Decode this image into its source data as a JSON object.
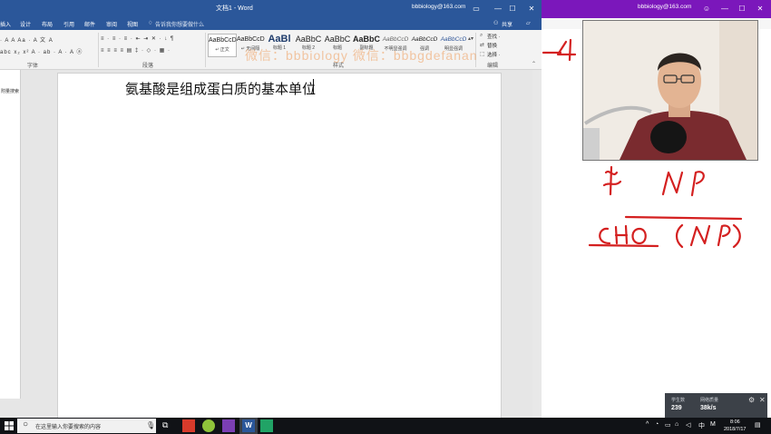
{
  "word": {
    "title": "文档1 - Word",
    "account": "bbbiology@163.com",
    "tabs": [
      "插入",
      "设计",
      "布局",
      "引用",
      "邮件",
      "审阅",
      "视图"
    ],
    "tell_me": "告诉我你想要做什么",
    "share": "共享",
    "font_row1": "· A A Aa · A 文 A",
    "font_row2": "abc x₂ x² A · ab · A · A ⓐ",
    "para_row1": "≡ · ≡ · ≡ · ⇤ ⇥ ✕ · ↓ ¶",
    "para_row2": "≡ ≡ ≡ ≡ ▤ ‡ · ◇ · ▦ ·",
    "group_font": "字体",
    "group_paragraph": "段落",
    "group_styles": "样式",
    "group_editing": "编辑",
    "styles": [
      {
        "sample": "AaBbCcD",
        "name": "↵ 正文"
      },
      {
        "sample": "AaBbCcD",
        "name": "↵ 无间隔"
      },
      {
        "sample": "AaBl",
        "name": "标题 1"
      },
      {
        "sample": "AaBbC",
        "name": "标题 2"
      },
      {
        "sample": "AaBbC",
        "name": "标题"
      },
      {
        "sample": "AaBbC",
        "name": "副标题"
      },
      {
        "sample": "AaBbCcD",
        "name": "不明显强调"
      },
      {
        "sample": "AaBbCcD",
        "name": "强调"
      },
      {
        "sample": "AaBbCcD",
        "name": "明显强调"
      }
    ],
    "editing": [
      "查找 ·",
      "替换",
      "选择 ·"
    ],
    "nav_text": "附量搜索",
    "document_text": "氨基酸是组成蛋白质的基本单位",
    "watermark": "微信：bbbiology  微信：bbbgdefanan"
  },
  "whiteboard": {
    "account": "bbbiology@163.com",
    "ink_color": "#d42020"
  },
  "stats": {
    "label_1": "学生数",
    "value_1": "239",
    "label_2": "网络质量",
    "value_2": "38k/s"
  },
  "taskbar": {
    "search_placeholder": "在这里输入你要搜索的内容",
    "ime": "中",
    "ime_mode": "M",
    "time": "8:06",
    "date": "2018/7/17"
  }
}
